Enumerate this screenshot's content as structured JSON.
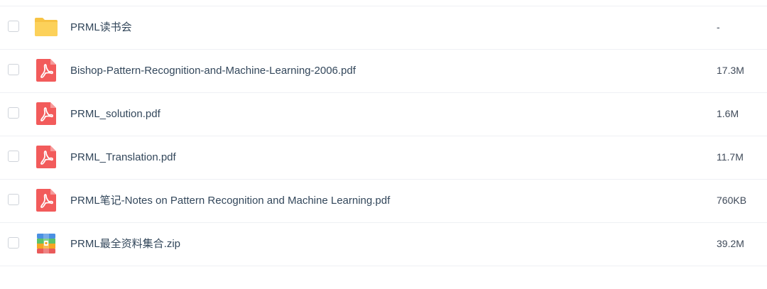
{
  "files": [
    {
      "name": "PRML读书会",
      "size": "-",
      "icon": "folder-icon"
    },
    {
      "name": "Bishop-Pattern-Recognition-and-Machine-Learning-2006.pdf",
      "size": "17.3M",
      "icon": "pdf-icon"
    },
    {
      "name": "PRML_solution.pdf",
      "size": "1.6M",
      "icon": "pdf-icon"
    },
    {
      "name": "PRML_Translation.pdf",
      "size": "11.7M",
      "icon": "pdf-icon"
    },
    {
      "name": "PRML笔记-Notes on Pattern Recognition and Machine Learning.pdf",
      "size": "760KB",
      "icon": "pdf-icon"
    },
    {
      "name": "PRML最全资料集合.zip",
      "size": "39.2M",
      "icon": "zip-icon"
    }
  ],
  "colors": {
    "folder": "#fcd15a",
    "pdf": "#f25b5b",
    "zip_blue": "#4a90e2",
    "zip_green": "#5cc26a",
    "zip_orange": "#f5a623",
    "zip_red": "#e95a5a"
  }
}
